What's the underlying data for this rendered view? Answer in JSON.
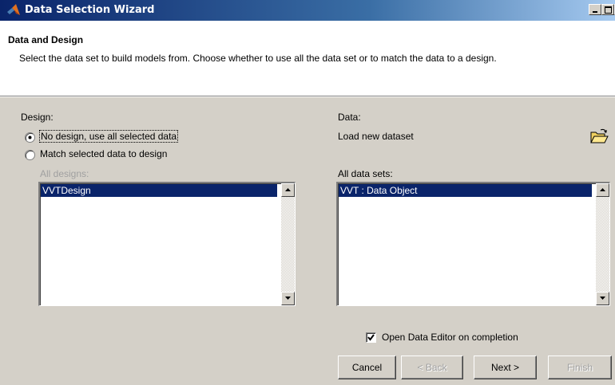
{
  "window": {
    "title": "Data Selection Wizard"
  },
  "header": {
    "title": "Data and Design",
    "description": "Select the data set to build models from. Choose whether to use all the data set or to match the data to a design."
  },
  "design": {
    "label": "Design:",
    "options": [
      {
        "label": "No design, use all selected data",
        "selected": true
      },
      {
        "label": "Match selected data to design",
        "selected": false
      }
    ],
    "list_label": "All designs:",
    "list_items": [
      "VVTDesign"
    ],
    "selected_item": "VVTDesign"
  },
  "data": {
    "label": "Data:",
    "load_label": "Load new dataset",
    "load_icon": "open-folder-icon",
    "list_label": "All data sets:",
    "list_items": [
      "VVT : Data Object"
    ],
    "selected_item": "VVT : Data Object"
  },
  "open_editor": {
    "label": "Open Data Editor on completion",
    "checked": true
  },
  "buttons": {
    "cancel": "Cancel",
    "back": "< Back",
    "next": "Next >",
    "finish": "Finish"
  },
  "colors": {
    "title_bar": "#0a246a",
    "selection": "#0a246a",
    "dialog_bg": "#d4d0c8"
  }
}
